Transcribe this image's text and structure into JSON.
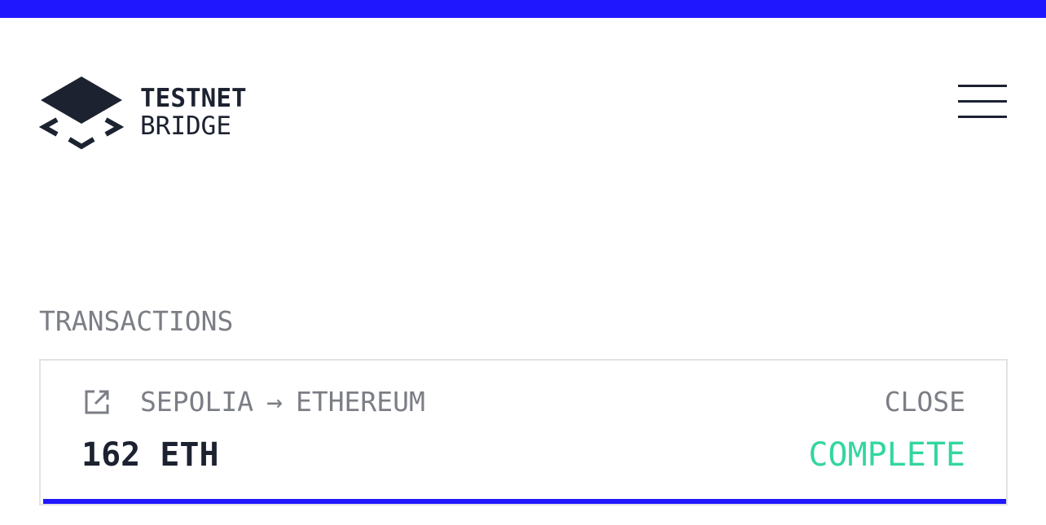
{
  "colors": {
    "accent": "#1f18ff",
    "text_dark": "#1c2230",
    "text_muted": "#7b7e85",
    "success": "#33d6a0",
    "border": "#e3e3e3"
  },
  "header": {
    "logo_icon": "bridge-diamond-icon",
    "logo_line1": "TESTNET",
    "logo_line2": "BRIDGE",
    "menu_icon": "hamburger-menu-icon"
  },
  "transactions": {
    "title": "TRANSACTIONS",
    "items": [
      {
        "link_icon": "external-link-icon",
        "from": "SEPOLIA",
        "arrow": "→",
        "to": "ETHEREUM",
        "close_label": "CLOSE",
        "amount": "162 ETH",
        "status": "COMPLETE",
        "progress": 1.0
      }
    ]
  }
}
